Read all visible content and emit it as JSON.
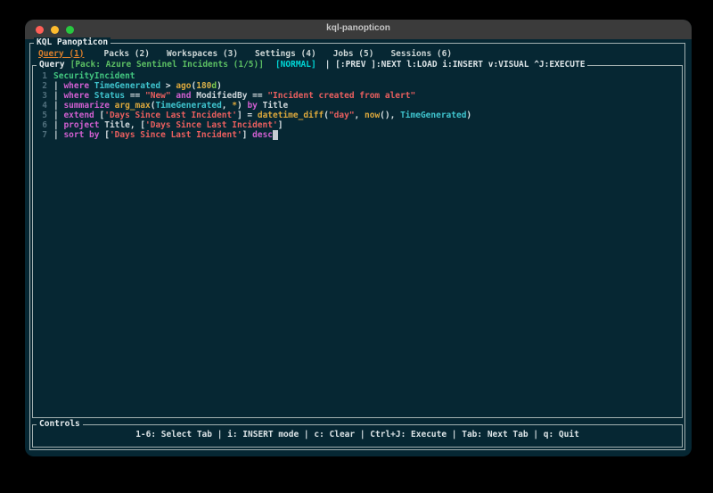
{
  "window": {
    "title": "kql-panopticon"
  },
  "app": {
    "frame_title": "KQL Panopticon"
  },
  "tabs": [
    {
      "label": "Query (1)",
      "active": true
    },
    {
      "label": "Packs (2)",
      "active": false
    },
    {
      "label": "Workspaces (3)",
      "active": false
    },
    {
      "label": "Settings (4)",
      "active": false
    },
    {
      "label": "Jobs (5)",
      "active": false
    },
    {
      "label": "Sessions (6)",
      "active": false
    }
  ],
  "query_panel": {
    "title": "Query",
    "pack_label": "[Pack: Azure Sentinel Incidents (1/5)]",
    "mode_badge": "[NORMAL]",
    "help_text": "| [:PREV ]:NEXT l:LOAD i:INSERT v:VISUAL ^J:EXECUTE",
    "code_lines": [
      {
        "num": "1",
        "tokens": [
          {
            "t": "SecurityIncident",
            "c": "tbl"
          }
        ]
      },
      {
        "num": "2",
        "tokens": [
          {
            "t": "| ",
            "c": "pun"
          },
          {
            "t": "where ",
            "c": "kw"
          },
          {
            "t": "TimeGenerated ",
            "c": "col"
          },
          {
            "t": "> ",
            "c": "pun"
          },
          {
            "t": "ago",
            "c": "fn"
          },
          {
            "t": "(",
            "c": "pun"
          },
          {
            "t": "180",
            "c": "num"
          },
          {
            "t": "d",
            "c": "unit"
          },
          {
            "t": ")",
            "c": "pun"
          }
        ]
      },
      {
        "num": "3",
        "tokens": [
          {
            "t": "| ",
            "c": "pun"
          },
          {
            "t": "where ",
            "c": "kw"
          },
          {
            "t": "Status ",
            "c": "col"
          },
          {
            "t": "== ",
            "c": "pun"
          },
          {
            "t": "\"New\" ",
            "c": "str"
          },
          {
            "t": "and ",
            "c": "kw"
          },
          {
            "t": "ModifiedBy ",
            "c": "id"
          },
          {
            "t": "== ",
            "c": "pun"
          },
          {
            "t": "\"Incident created from alert\"",
            "c": "str"
          }
        ]
      },
      {
        "num": "4",
        "tokens": [
          {
            "t": "| ",
            "c": "pun"
          },
          {
            "t": "summarize ",
            "c": "kw"
          },
          {
            "t": "arg_max",
            "c": "fn"
          },
          {
            "t": "(",
            "c": "pun"
          },
          {
            "t": "TimeGenerated",
            "c": "col"
          },
          {
            "t": ", ",
            "c": "pun"
          },
          {
            "t": "*",
            "c": "fn"
          },
          {
            "t": ") ",
            "c": "pun"
          },
          {
            "t": "by ",
            "c": "kw"
          },
          {
            "t": "Title",
            "c": "id"
          }
        ]
      },
      {
        "num": "5",
        "tokens": [
          {
            "t": "| ",
            "c": "pun"
          },
          {
            "t": "extend ",
            "c": "kw"
          },
          {
            "t": "[",
            "c": "pun"
          },
          {
            "t": "'Days Since Last Incident'",
            "c": "str"
          },
          {
            "t": "] = ",
            "c": "pun"
          },
          {
            "t": "datetime_diff",
            "c": "fn"
          },
          {
            "t": "(",
            "c": "pun"
          },
          {
            "t": "\"day\"",
            "c": "str"
          },
          {
            "t": ", ",
            "c": "pun"
          },
          {
            "t": "now",
            "c": "fn"
          },
          {
            "t": "(), ",
            "c": "pun"
          },
          {
            "t": "TimeGenerated",
            "c": "col"
          },
          {
            "t": ")",
            "c": "pun"
          }
        ]
      },
      {
        "num": "6",
        "tokens": [
          {
            "t": "| ",
            "c": "pun"
          },
          {
            "t": "project ",
            "c": "kw"
          },
          {
            "t": "Title",
            "c": "id"
          },
          {
            "t": ", [",
            "c": "pun"
          },
          {
            "t": "'Days Since Last Incident'",
            "c": "str"
          },
          {
            "t": "]",
            "c": "pun"
          }
        ]
      },
      {
        "num": "7",
        "tokens": [
          {
            "t": "| ",
            "c": "pun"
          },
          {
            "t": "sort by ",
            "c": "kw"
          },
          {
            "t": "[",
            "c": "pun"
          },
          {
            "t": "'Days Since Last Incident'",
            "c": "str"
          },
          {
            "t": "] ",
            "c": "pun"
          },
          {
            "t": "desc",
            "c": "kw"
          },
          {
            "t": " ",
            "c": "cur"
          }
        ]
      }
    ]
  },
  "controls_panel": {
    "title": "Controls",
    "text": "1-6: Select Tab | i: INSERT mode | c: Clear | Ctrl+J: Execute | Tab: Next Tab | q: Quit"
  },
  "colors": {
    "terminal_background": "#062733",
    "titlebar_background": "#3b3b3b",
    "border": "#a3b1b1",
    "active_tab": "#dd7f2c",
    "pack_label": "#5cbf63",
    "mode_badge": "#00d7d7",
    "keyword": "#d05fd0",
    "column": "#3fc3cd",
    "function": "#dca83c",
    "string": "#ea5f5f",
    "table": "#42c57f",
    "traffic_red": "#ff5f57",
    "traffic_yellow": "#febc2e",
    "traffic_green": "#28c840"
  }
}
